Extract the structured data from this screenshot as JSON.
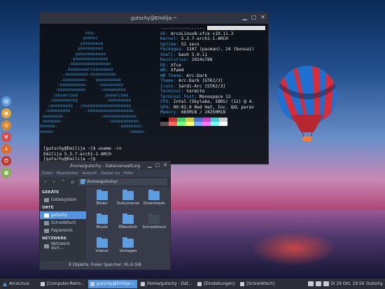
{
  "colors": {
    "accent": "#5294e2",
    "terminal_blue": "#3a9ad9"
  },
  "terminal": {
    "title": "gutschy@Emilija:~",
    "window_controls": [
      "▁",
      "▢",
      "✕"
    ],
    "info": [
      {
        "k": "OS:",
        "v": "ArcoLinuxB-xfce v19.11.3"
      },
      {
        "k": "Kernel:",
        "v": "5.3.7-arch1-1-ARCH"
      },
      {
        "k": "Uptime:",
        "v": "52 secs"
      },
      {
        "k": "Packages:",
        "v": "1107 (pacman), 24 (bonsai)"
      },
      {
        "k": "Shell:",
        "v": "bash 5.0.11"
      },
      {
        "k": "Resolution:",
        "v": "1024x768"
      },
      {
        "k": "DE:",
        "v": "Xfce"
      },
      {
        "k": "WM:",
        "v": "Xfwm4"
      },
      {
        "k": "WM Theme:",
        "v": "Arc-Dark"
      },
      {
        "k": "Theme:",
        "v": "Arc-Dark [GTK2/3]"
      },
      {
        "k": "Icons:",
        "v": "Sardi-Arc [GTK2/3]"
      },
      {
        "k": "Terminal:",
        "v": "termite"
      },
      {
        "k": "Terminal Font:",
        "v": "Monospace 12"
      },
      {
        "k": "CPU:",
        "v": "Intel (Skylake, IBRS) (12) @ 4."
      },
      {
        "k": "GPU:",
        "v": "00:02.0 Red Hat, Inc. QXL parav"
      },
      {
        "k": "Memory:",
        "v": "665MiB / 24250MiB"
      }
    ],
    "separator": "-----------------",
    "palette": [
      "#000000",
      "#cc3333",
      "#44cc66",
      "#cccc44",
      "#4477cc",
      "#cc44cc",
      "#44cccc",
      "#cccccc",
      "#555555",
      "#ff6666",
      "#77ff88",
      "#ffff77",
      "#77aaff",
      "#ff77ff",
      "#77ffff",
      "#ffffff"
    ],
    "logo_lines": [
      "                  ooo:",
      "                 yoooo/",
      "                yoooooooo",
      "               yooooooooo",
      "              yooooooooooo",
      "            .yooooooooooooo",
      "           .oooooooooooooooo",
      "          .oooooooarcoooooooo",
      "         .ooooooooo-oooooooooo",
      "        .ooooooooo-   oooooooooo",
      "       :oooooooooo.    :ooooooooo",
      "      :ooooooooooo      :ooooooooo",
      "     :oooarcooo          .oooarcooo",
      "    :oooooooooy           .ooooooooo",
      "   :ooooooooo   /ooooooooooooooooooo",
      "  :ooooooooo     .-oooooooooooooooooo.",
      " oooooooo-              -ooooooooooooo.",
      " ooooooo-                  -ooooooooooo.",
      "oooooo-                        -oooooooo.",
      "ooooo-                             -ooooo."
    ],
    "shell_lines": [
      "[gutschy@Emilija ~]$ uname -rn",
      "Emilija 5.3.7-arch1-1-ARCH",
      "[gutschy@Emilija ~]$ "
    ]
  },
  "file_manager": {
    "title": "/home/gutschy - Dateiverwaltung",
    "window_controls": [
      "▁",
      "▢",
      "✕"
    ],
    "menu": [
      "Datei",
      "Bearbeiten",
      "Ansicht",
      "Gehen zu",
      "Hilfe"
    ],
    "toolbar": {
      "back": "‹",
      "forward": "›",
      "up": "⌃",
      "home": "⌂",
      "path": "/home/gutschy/"
    },
    "sidebar": [
      {
        "section": "GERÄTE",
        "items": [
          {
            "label": "Dateisystem",
            "selected": false
          }
        ]
      },
      {
        "section": "ORTE",
        "items": [
          {
            "label": "gutschy",
            "selected": true
          },
          {
            "label": "Schreibtisch",
            "selected": false
          },
          {
            "label": "Papierkorb",
            "selected": false
          }
        ]
      },
      {
        "section": "NETZWERK",
        "items": [
          {
            "label": "Netzwerk durc...",
            "selected": false
          }
        ]
      }
    ],
    "folders": [
      {
        "label": "Bilder",
        "dark": false
      },
      {
        "label": "Dokumente",
        "dark": false
      },
      {
        "label": "Downloads",
        "dark": false
      },
      {
        "label": "Musik",
        "dark": false
      },
      {
        "label": "Öffentlich",
        "dark": false
      },
      {
        "label": "Schreibtisch",
        "dark": true
      },
      {
        "label": "Videos",
        "dark": false
      },
      {
        "label": "Vorlagen",
        "dark": false
      }
    ],
    "status": "8 Objekte, Freier Speicher: 91,6 GiB"
  },
  "dock": [
    {
      "icon": "files-icon",
      "glyph": "▤",
      "color": "#5e9de0"
    },
    {
      "icon": "browser-icon",
      "glyph": "◉",
      "color": "#e0a63a"
    },
    {
      "icon": "settings-icon",
      "glyph": "◎",
      "color": "#d88a2a"
    },
    {
      "icon": "vivaldi-icon",
      "glyph": "V",
      "color": "#e04848"
    },
    {
      "icon": "install-icon",
      "glyph": "↓",
      "color": "#e06a2a"
    },
    {
      "icon": "power-icon",
      "glyph": "⏻",
      "color": "#c0392b"
    },
    {
      "icon": "image-icon",
      "glyph": "▦",
      "color": "#7fb04a"
    }
  ],
  "taskbar": {
    "start_label": "ArcoLinux",
    "tasks": [
      {
        "label": "[Computer-Retro...",
        "active": false
      },
      {
        "label": "gutschy@Emilija:~",
        "active": true
      },
      {
        "label": "/home/gutschy - Dat...",
        "active": false
      },
      {
        "label": "[Einstellungen]",
        "active": false
      },
      {
        "label": "[Schreibtisch]",
        "active": false
      }
    ],
    "clock": "Di 29 Okt, 19:59",
    "user": "Gutschy"
  }
}
